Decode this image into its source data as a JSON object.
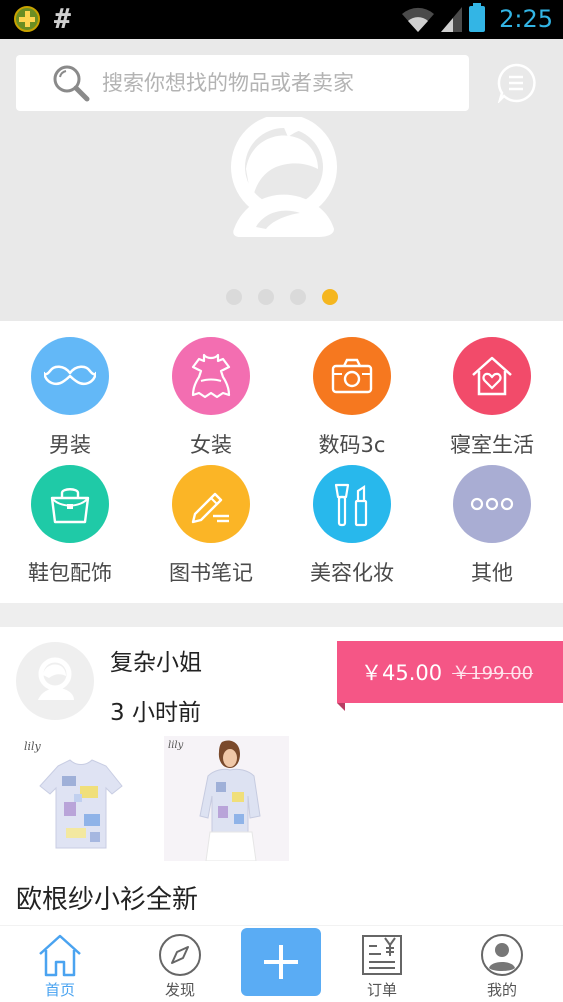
{
  "status_bar": {
    "left_icons": [
      "app-notification-icon",
      "hash-icon"
    ],
    "hash_glyph": "#",
    "right_icons": [
      "wifi-icon",
      "signal-icon",
      "battery-icon"
    ],
    "time": "2:25"
  },
  "search": {
    "placeholder": "搜索你想找的物品或者卖家"
  },
  "banner": {
    "logo_icon": "rabbit-logo-icon",
    "page_count": 4,
    "active_page": 4
  },
  "categories": [
    {
      "label": "男装",
      "icon": "mustache-icon",
      "color": "#63b8f7"
    },
    {
      "label": "女装",
      "icon": "dress-icon",
      "color": "#f36eb1"
    },
    {
      "label": "数码3c",
      "icon": "camera-icon",
      "color": "#f6781f"
    },
    {
      "label": "寝室生活",
      "icon": "home-heart-icon",
      "color": "#f24b6a"
    },
    {
      "label": "鞋包配饰",
      "icon": "handbag-icon",
      "color": "#1fcaa7"
    },
    {
      "label": "图书笔记",
      "icon": "pencil-note-icon",
      "color": "#fbb526"
    },
    {
      "label": "美容化妆",
      "icon": "makeup-brush-icon",
      "color": "#28b8ec"
    },
    {
      "label": "其他",
      "icon": "more-dots-icon",
      "color": "#a9add3"
    }
  ],
  "listing": {
    "seller_name": "复杂小姐",
    "posted_time": "3 小时前",
    "price": "￥45.00",
    "original_price": "￥199.00",
    "title": "欧根纱小衫全新",
    "photo_brand": "lily"
  },
  "bottom_nav": {
    "items": [
      {
        "label": "首页",
        "icon": "home-icon",
        "active": true
      },
      {
        "label": "发现",
        "icon": "compass-icon",
        "active": false
      },
      {
        "label": "订单",
        "icon": "order-receipt-icon",
        "active": false
      },
      {
        "label": "我的",
        "icon": "user-icon",
        "active": false
      }
    ],
    "publish_icon": "plus-icon"
  },
  "colors": {
    "accent": "#5aacf4",
    "price_tag": "#f55686",
    "dot_active": "#f5b61f"
  }
}
